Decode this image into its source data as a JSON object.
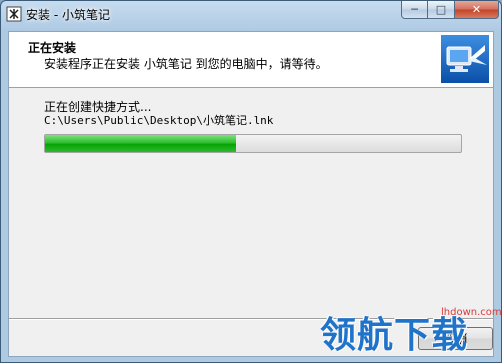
{
  "window": {
    "title": "安装 - 小筑笔记",
    "controls": {
      "minimize": "─",
      "maximize": "□",
      "close": "✕"
    }
  },
  "header": {
    "title": "正在安装",
    "subtitle": "安装程序正在安装 小筑笔记 到您的电脑中，请等待。",
    "image_icon": "computer-install-icon"
  },
  "body": {
    "status": "正在创建快捷方式...",
    "detail": "C:\\Users\\Public\\Desktop\\小筑笔记.lnk",
    "progress_percent": 46
  },
  "footer": {
    "cancel_label": "取消"
  },
  "watermark": {
    "logo_text": "领航下载",
    "url": "lhdown.com"
  },
  "colors": {
    "progress": "#06a406",
    "watermark": "#1f73c9"
  }
}
